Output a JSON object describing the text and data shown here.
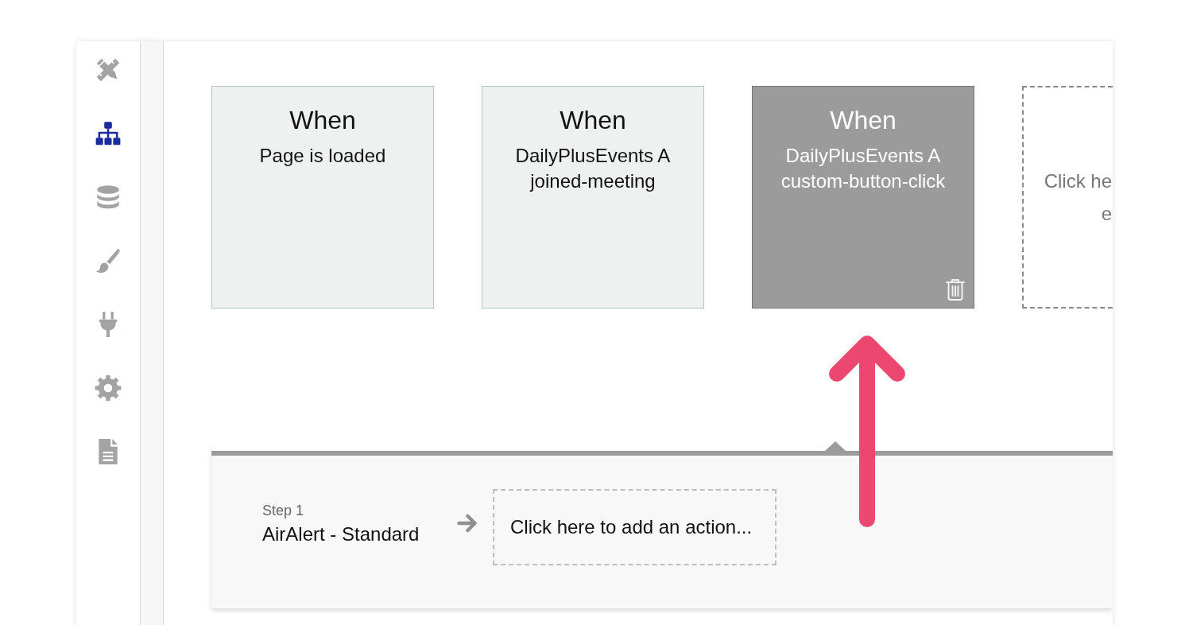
{
  "sidebar": {
    "items": [
      {
        "selected": false
      },
      {
        "selected": true
      },
      {
        "selected": false
      },
      {
        "selected": false
      },
      {
        "selected": false
      },
      {
        "selected": false
      },
      {
        "selected": false
      }
    ]
  },
  "triggers": [
    {
      "label": "When",
      "event": "Page is loaded",
      "selected": false
    },
    {
      "label": "When",
      "event": "DailyPlusEvents A joined-meeting",
      "selected": false
    },
    {
      "label": "When",
      "event": "DailyPlusEvents A custom-button-click",
      "selected": true
    }
  ],
  "add_event_card": {
    "lines": [
      "Click he",
      "e"
    ]
  },
  "step_panel": {
    "step_label": "Step 1",
    "step_name": "AirAlert - Standard",
    "add_action": "Click here to add an action..."
  }
}
